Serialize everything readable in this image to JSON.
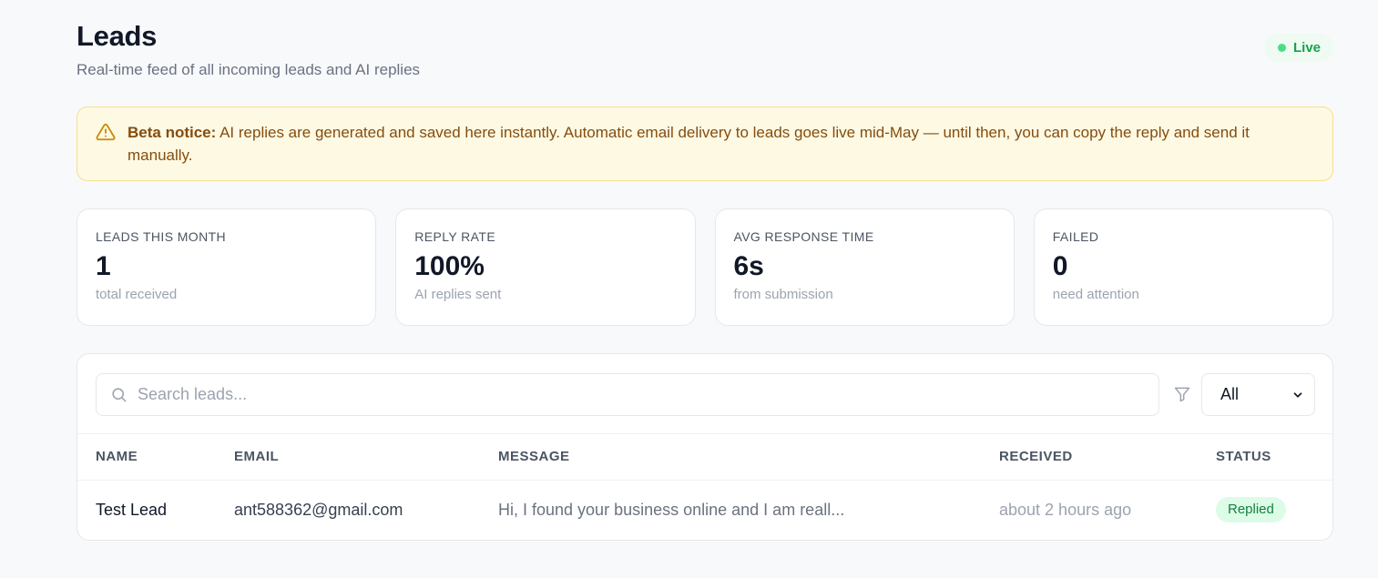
{
  "header": {
    "title": "Leads",
    "subtitle": "Real-time feed of all incoming leads and AI replies",
    "live_label": "Live"
  },
  "notice": {
    "icon": "warning-triangle-icon",
    "bold": "Beta notice:",
    "text": " AI replies are generated and saved here instantly. Automatic email delivery to leads goes live mid-May — until then, you can copy the reply and send it manually."
  },
  "stats": [
    {
      "label": "LEADS THIS MONTH",
      "value": "1",
      "sub": "total received"
    },
    {
      "label": "REPLY RATE",
      "value": "100%",
      "sub": "AI replies sent"
    },
    {
      "label": "AVG RESPONSE TIME",
      "value": "6s",
      "sub": "from submission"
    },
    {
      "label": "FAILED",
      "value": "0",
      "sub": "need attention"
    }
  ],
  "toolbar": {
    "search_placeholder": "Search leads...",
    "filter_icon": "filter-icon",
    "status_filter_value": "All"
  },
  "table": {
    "columns": [
      "NAME",
      "EMAIL",
      "MESSAGE",
      "RECEIVED",
      "STATUS"
    ],
    "rows": [
      {
        "name": "Test Lead",
        "email": "ant588362@gmail.com",
        "message": "Hi, I found your business online and I am reall...",
        "received": "about 2 hours ago",
        "status": "Replied"
      }
    ]
  },
  "colors": {
    "background": "#f8f9fb",
    "live_green": "#16a34a",
    "notice_bg": "#fef9e3",
    "notice_text": "#854d0e",
    "replied_bg": "#dcfce7",
    "replied_text": "#15803d"
  }
}
